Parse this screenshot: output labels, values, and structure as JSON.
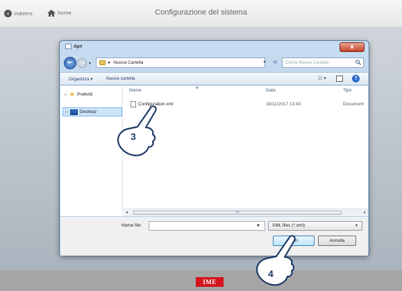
{
  "appbar": {
    "back_label": "indietro",
    "home_label": "home",
    "title": "Configurazione del sistema"
  },
  "dialog": {
    "title": "Apri",
    "close_glyph": "x",
    "address": {
      "path_segment": "Nuova Cartella",
      "search_placeholder": "Cerca Nuova Cartella"
    },
    "toolbar": {
      "organize_label": "Organizza ▾",
      "new_folder_label": "Nuova cartella",
      "help_glyph": "?"
    },
    "nav": {
      "favorites_label": "Preferiti",
      "desktop_label": "Desktop"
    },
    "columns": {
      "name": "Nome",
      "date": "Data",
      "type": "Tipo"
    },
    "files": [
      {
        "name": "Configuration.xml",
        "date": "16/11/2017 13:43",
        "type": "Document"
      }
    ],
    "scroll_thumb_glyph": "III",
    "bottom": {
      "filename_label": "Nome file:",
      "filename_value": "",
      "filter_value": "XML files (*.xml)",
      "open_label": "Apri",
      "cancel_label": "Annulla"
    }
  },
  "overlays": {
    "step_3": "3",
    "step_4": "4"
  },
  "brand": {
    "logo_text": "IME",
    "logo_color": "#d4141c"
  },
  "icons": [
    "back-circle-icon",
    "home-icon",
    "folder-icon",
    "search-icon",
    "star-icon",
    "desktop-icon",
    "xml-file-icon",
    "help-icon",
    "hand-pointer-icon"
  ]
}
